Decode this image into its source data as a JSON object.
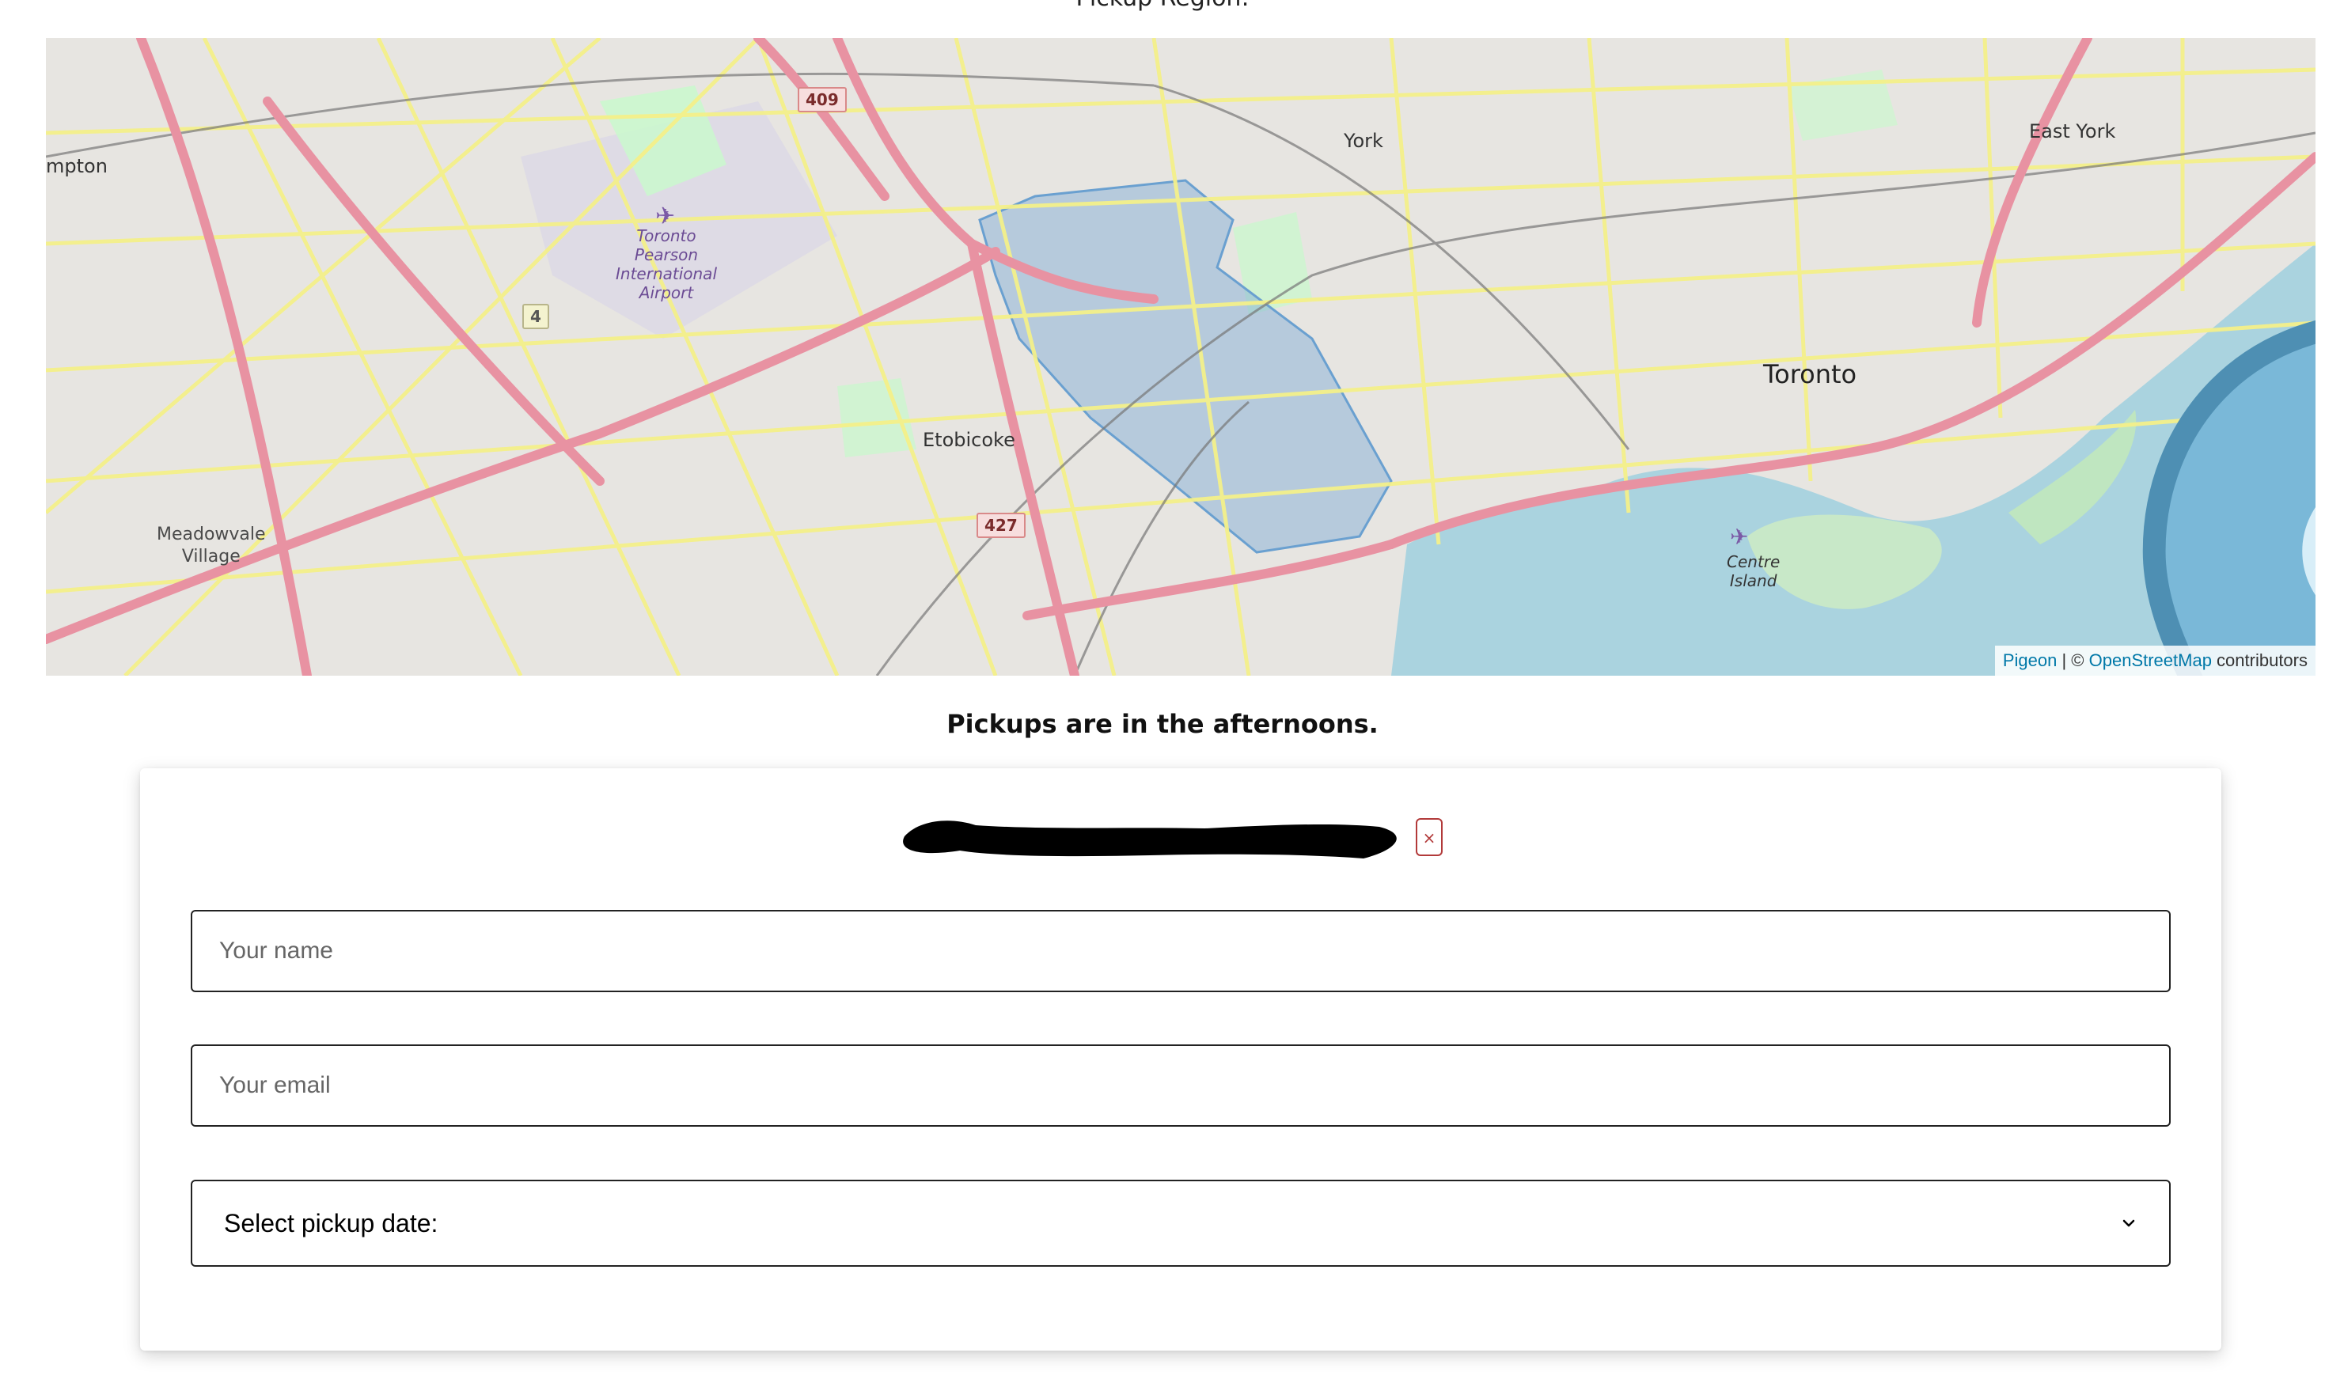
{
  "map": {
    "title": "Pickup Region:",
    "labels": {
      "york": "York",
      "east_york": "East York",
      "toronto": "Toronto",
      "etobicoke": "Etobicoke",
      "brampton_partial": "mpton",
      "meadowvale": "Meadowvale\nVillage",
      "pearson": "Toronto\nPearson\nInternational\nAirport",
      "centre_island": "Centre\nIsland"
    },
    "shields": {
      "s409": "409",
      "s427": "427",
      "s4": "4"
    },
    "attribution": {
      "pigeon": "Pigeon",
      "separator": " | © ",
      "osm": "OpenStreetMap",
      "suffix": " contributors"
    },
    "colors": {
      "water": "#aad3df",
      "land": "#f1efe9",
      "highway": "#e892a2",
      "road": "#f7fabf",
      "park": "#c8facc",
      "region": "#7aa9d6",
      "accent_link": "#0078a8"
    }
  },
  "note": {
    "text": "Pickups are in the afternoons."
  },
  "form": {
    "close_label": "×",
    "name_placeholder": "Your name",
    "email_placeholder": "Your email",
    "pickup_select_value": "Select pickup date:"
  }
}
